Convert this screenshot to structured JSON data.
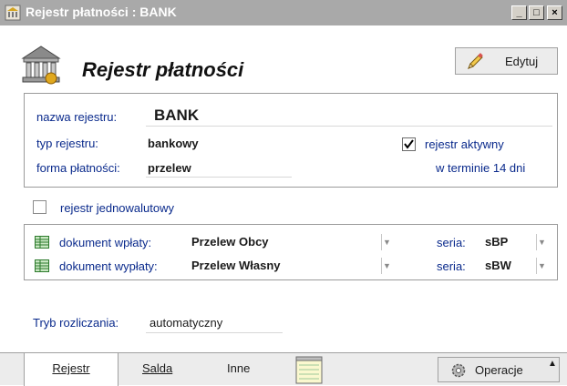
{
  "window": {
    "title": "Rejestr płatności : BANK",
    "min_symbol": "_",
    "max_symbol": "□",
    "close_symbol": "×"
  },
  "header": {
    "title": "Rejestr płatności",
    "edit_label": "Edytuj"
  },
  "register": {
    "name_label": "nazwa rejestru:",
    "name_value": "BANK",
    "type_label": "typ rejestru:",
    "type_value": "bankowy",
    "active_label": "rejestr aktywny",
    "active_checked": true,
    "payment_label": "forma płatności:",
    "payment_value": "przelew",
    "term_text": "w terminie 14 dni"
  },
  "single_currency": {
    "label": "rejestr jednowalutowy",
    "checked": false
  },
  "documents": {
    "deposit_label": "dokument wpłaty:",
    "deposit_value": "Przelew Obcy",
    "deposit_series_label": "seria:",
    "deposit_series_value": "sBP",
    "withdrawal_label": "dokument wypłaty:",
    "withdrawal_value": "Przelew Własny",
    "withdrawal_series_label": "seria:",
    "withdrawal_series_value": "sBW"
  },
  "settlement": {
    "label": "Tryb rozliczania:",
    "value": "automatyczny"
  },
  "tabs": [
    {
      "label": "Rejestr"
    },
    {
      "label": "Salda"
    },
    {
      "label": "Inne"
    }
  ],
  "operations_label": "Operacje",
  "icons": {
    "app": "bank-building-icon",
    "edit": "pencil-icon",
    "notes": "notepad-icon",
    "operations": "gear-icon",
    "documents": "document-grid-icon"
  }
}
